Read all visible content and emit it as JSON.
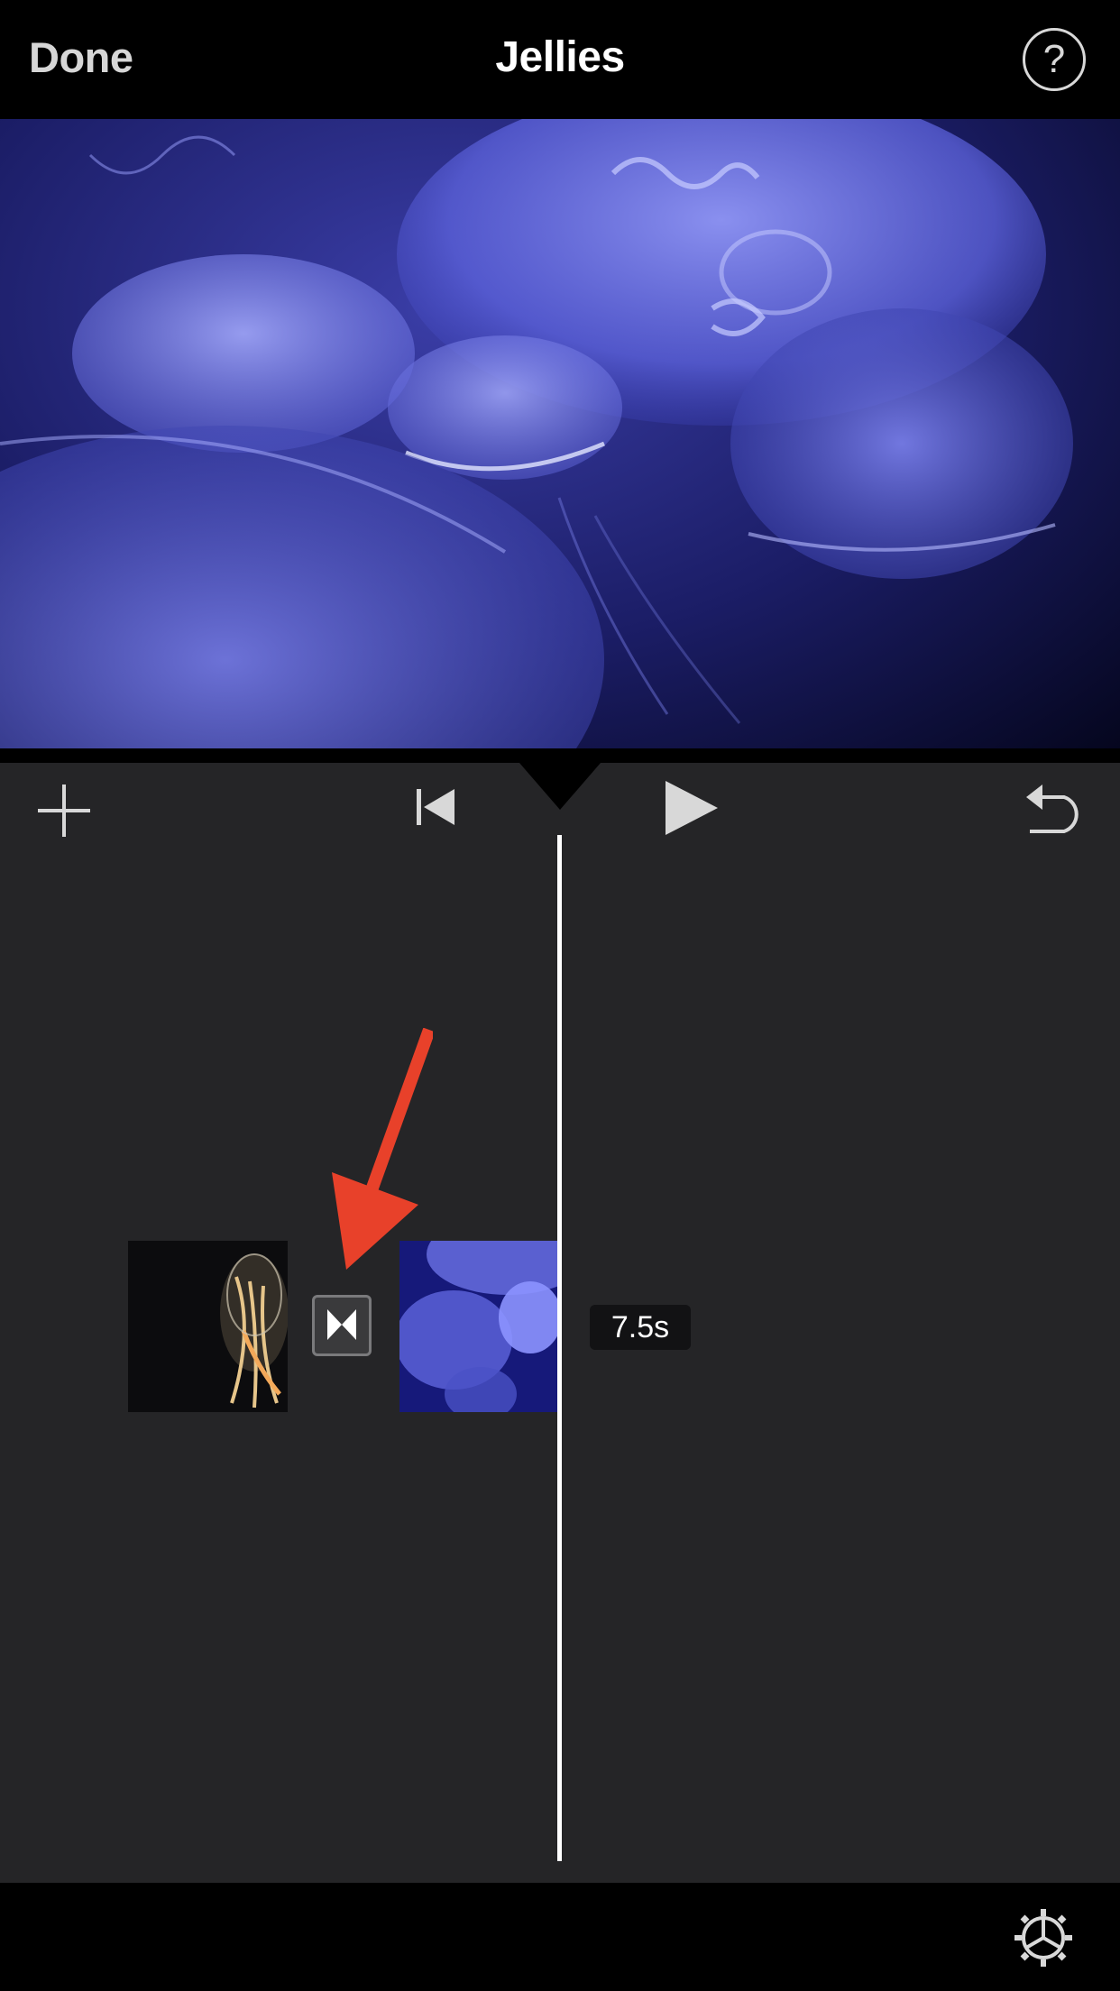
{
  "header": {
    "done_label": "Done",
    "title": "Jellies",
    "help_label": "?"
  },
  "toolbar": {
    "add_icon": "plus-icon",
    "skip_back_icon": "skip-to-start-icon",
    "play_icon": "play-icon",
    "undo_icon": "undo-icon"
  },
  "timeline": {
    "clips": [
      {
        "name": "comb-jelly-clip"
      },
      {
        "name": "moon-jelly-clip"
      }
    ],
    "transition_icon": "transition-icon",
    "duration_label": "7.5s",
    "annotation_color": "#e8412a"
  },
  "bottombar": {
    "settings_icon": "gear-icon"
  },
  "colors": {
    "background": "#252527",
    "bar": "#000000",
    "accent": "#e8412a"
  }
}
